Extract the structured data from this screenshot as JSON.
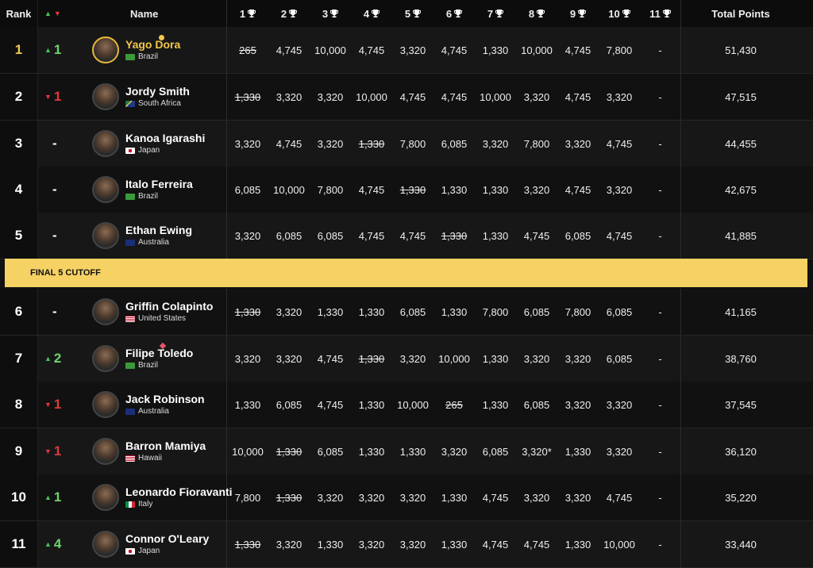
{
  "header": {
    "rank": "Rank",
    "name": "Name",
    "events": [
      "1",
      "2",
      "3",
      "4",
      "5",
      "6",
      "7",
      "8",
      "9",
      "10",
      "11"
    ],
    "total": "Total Points"
  },
  "cutoff_label": "FINAL 5 CUTOFF",
  "colors": {
    "gold": "#f2c84b",
    "up": "#6ed36e",
    "down": "#e0393e",
    "cutoff": "#f6d163"
  },
  "rows": [
    {
      "rank": "1",
      "move": "1",
      "dir": "up",
      "name": "Yago Dora",
      "country": "Brazil",
      "flag": "br",
      "leader": true,
      "events": [
        "265",
        "4,745",
        "10,000",
        "4,745",
        "3,320",
        "4,745",
        "1,330",
        "10,000",
        "4,745",
        "7,800",
        "-"
      ],
      "strike": [
        0
      ],
      "total": "51,430"
    },
    {
      "rank": "2",
      "move": "1",
      "dir": "down",
      "name": "Jordy Smith",
      "country": "South Africa",
      "flag": "za",
      "events": [
        "1,330",
        "3,320",
        "3,320",
        "10,000",
        "4,745",
        "4,745",
        "10,000",
        "3,320",
        "4,745",
        "3,320",
        "-"
      ],
      "strike": [
        0
      ],
      "total": "47,515"
    },
    {
      "rank": "3",
      "move": "-",
      "dir": "none",
      "name": "Kanoa Igarashi",
      "country": "Japan",
      "flag": "jp",
      "events": [
        "3,320",
        "4,745",
        "3,320",
        "1,330",
        "7,800",
        "6,085",
        "3,320",
        "7,800",
        "3,320",
        "4,745",
        "-"
      ],
      "strike": [
        3
      ],
      "total": "44,455"
    },
    {
      "rank": "4",
      "move": "-",
      "dir": "none",
      "name": "Italo Ferreira",
      "country": "Brazil",
      "flag": "br",
      "events": [
        "6,085",
        "10,000",
        "7,800",
        "4,745",
        "1,330",
        "1,330",
        "1,330",
        "3,320",
        "4,745",
        "3,320",
        "-"
      ],
      "strike": [
        4
      ],
      "total": "42,675"
    },
    {
      "rank": "5",
      "move": "-",
      "dir": "none",
      "name": "Ethan Ewing",
      "country": "Australia",
      "flag": "au",
      "events": [
        "3,320",
        "6,085",
        "6,085",
        "4,745",
        "4,745",
        "1,330",
        "1,330",
        "4,745",
        "6,085",
        "4,745",
        "-"
      ],
      "strike": [
        5
      ],
      "total": "41,885"
    },
    {
      "rank": "6",
      "move": "-",
      "dir": "none",
      "name": "Griffin Colapinto",
      "country": "United States",
      "flag": "us",
      "events": [
        "1,330",
        "3,320",
        "1,330",
        "1,330",
        "6,085",
        "1,330",
        "7,800",
        "6,085",
        "7,800",
        "6,085",
        "-"
      ],
      "strike": [
        0
      ],
      "total": "41,165"
    },
    {
      "rank": "7",
      "move": "2",
      "dir": "up",
      "name": "Filipe Toledo",
      "country": "Brazil",
      "flag": "br",
      "diamond": true,
      "events": [
        "3,320",
        "3,320",
        "4,745",
        "1,330",
        "3,320",
        "10,000",
        "1,330",
        "3,320",
        "3,320",
        "6,085",
        "-"
      ],
      "strike": [
        3
      ],
      "total": "38,760"
    },
    {
      "rank": "8",
      "move": "1",
      "dir": "down",
      "name": "Jack Robinson",
      "country": "Australia",
      "flag": "au",
      "events": [
        "1,330",
        "6,085",
        "4,745",
        "1,330",
        "10,000",
        "265",
        "1,330",
        "6,085",
        "3,320",
        "3,320",
        "-"
      ],
      "strike": [
        5
      ],
      "total": "37,545"
    },
    {
      "rank": "9",
      "move": "1",
      "dir": "down",
      "name": "Barron Mamiya",
      "country": "Hawaii",
      "flag": "hi",
      "events": [
        "10,000",
        "1,330",
        "6,085",
        "1,330",
        "1,330",
        "3,320",
        "6,085",
        "3,320*",
        "1,330",
        "3,320",
        "-"
      ],
      "strike": [
        1
      ],
      "red": [
        7
      ],
      "total": "36,120"
    },
    {
      "rank": "10",
      "move": "1",
      "dir": "up",
      "name": "Leonardo Fioravanti",
      "country": "Italy",
      "flag": "it",
      "events": [
        "7,800",
        "1,330",
        "3,320",
        "3,320",
        "3,320",
        "1,330",
        "4,745",
        "3,320",
        "3,320",
        "4,745",
        "-"
      ],
      "strike": [
        1
      ],
      "total": "35,220"
    },
    {
      "rank": "11",
      "move": "4",
      "dir": "up",
      "name": "Connor O'Leary",
      "country": "Japan",
      "flag": "jp",
      "events": [
        "1,330",
        "3,320",
        "1,330",
        "3,320",
        "3,320",
        "1,330",
        "4,745",
        "4,745",
        "1,330",
        "10,000",
        "-"
      ],
      "strike": [
        0
      ],
      "total": "33,440"
    }
  ]
}
